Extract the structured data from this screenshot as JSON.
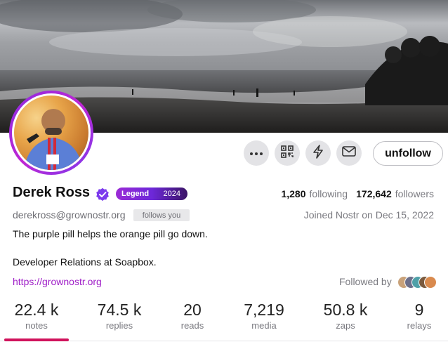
{
  "profile": {
    "name": "Derek Ross",
    "badge_label": "Legend",
    "badge_year": "2024",
    "nip05": "derekross@grownostr.org",
    "follows_you": "follows you",
    "joined": "Joined Nostr on Dec 15, 2022",
    "bio_line1": "The purple pill helps the orange pill go down.",
    "bio_line2": "Developer Relations at Soapbox.",
    "website": "https://grownostr.org"
  },
  "counts": {
    "following_num": "1,280",
    "following_label": "following",
    "followers_num": "172,642",
    "followers_label": "followers"
  },
  "actions": {
    "unfollow_label": "unfollow",
    "more_icon": "ellipsis-icon",
    "qr_icon": "qr-code-icon",
    "zap_icon": "lightning-icon",
    "message_icon": "envelope-icon"
  },
  "followed_by": {
    "label": "Followed by"
  },
  "stats": [
    {
      "value": "22.4 k",
      "label": "notes"
    },
    {
      "value": "74.5 k",
      "label": "replies"
    },
    {
      "value": "20",
      "label": "reads"
    },
    {
      "value": "7,219",
      "label": "media"
    },
    {
      "value": "50.8 k",
      "label": "zaps"
    },
    {
      "value": "9",
      "label": "relays"
    }
  ],
  "colors": {
    "accent": "#a020c8",
    "active_tab": "#d0135c",
    "verified": "#7c3aed"
  }
}
